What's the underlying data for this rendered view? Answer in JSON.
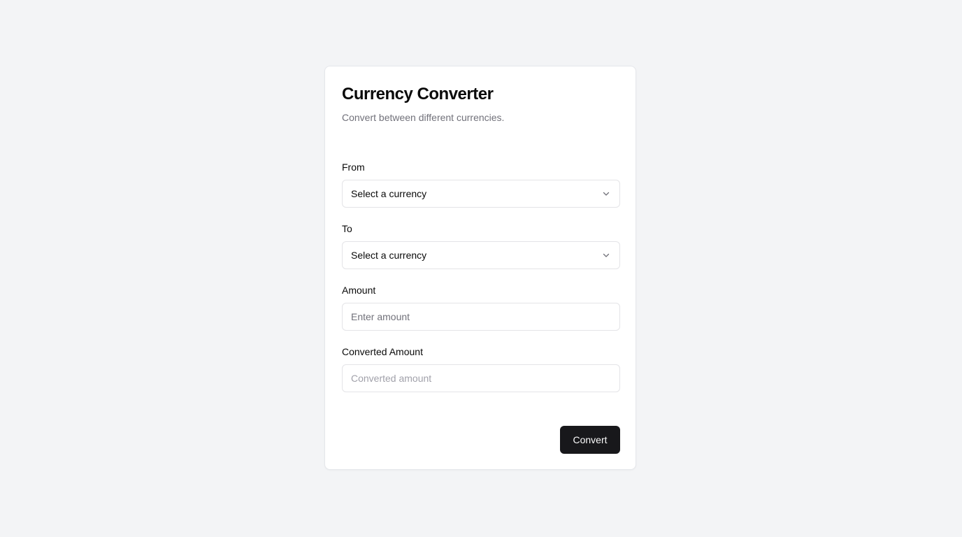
{
  "converter": {
    "title": "Currency Converter",
    "description": "Convert between different currencies.",
    "from": {
      "label": "From",
      "selected": "Select a currency"
    },
    "to": {
      "label": "To",
      "selected": "Select a currency"
    },
    "amount": {
      "label": "Amount",
      "placeholder": "Enter amount",
      "value": ""
    },
    "converted": {
      "label": "Converted Amount",
      "placeholder": "Converted amount",
      "value": ""
    },
    "convert_label": "Convert"
  },
  "icons": {
    "from_select": "chevron-down-icon",
    "to_select": "chevron-down-icon"
  },
  "colors": {
    "page_background": "#f3f4f6",
    "card_background": "#ffffff",
    "primary_button": "#18181b",
    "muted_text": "#71717a"
  }
}
